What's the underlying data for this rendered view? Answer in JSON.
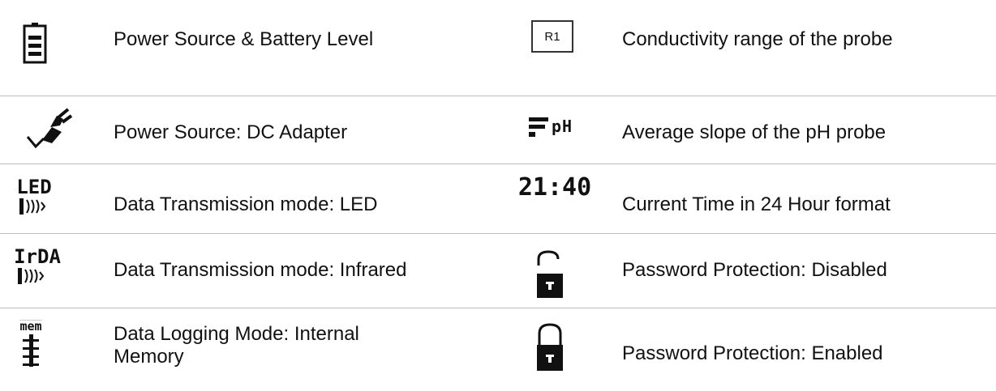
{
  "left_column": [
    {
      "icon": "battery-icon",
      "label": "Power Source & Battery Level"
    },
    {
      "icon": "dc-adapter-plug-icon",
      "label": "Power Source: DC Adapter"
    },
    {
      "icon": "led-transmission-icon",
      "icon_text": "LED",
      "label": "Data Transmission mode: LED"
    },
    {
      "icon": "infrared-transmission-icon",
      "icon_text": "IrDA",
      "label": "Data Transmission mode: Infrared"
    },
    {
      "icon": "internal-memory-icon",
      "icon_text": "mem",
      "label": "Data Logging Mode: Internal Memory"
    }
  ],
  "right_column": [
    {
      "icon": "conductivity-range-icon",
      "icon_text": "R1",
      "label": "Conductivity range of the probe"
    },
    {
      "icon": "ph-slope-icon",
      "icon_text": "pH",
      "label": "Average slope of the pH probe"
    },
    {
      "icon": "clock-time-icon",
      "icon_text": "21:40",
      "label": "Current Time in 24 Hour format"
    },
    {
      "icon": "unlocked-padlock-icon",
      "label": "Password Protection: Disabled"
    },
    {
      "icon": "locked-padlock-icon",
      "label": "Password Protection: Enabled"
    }
  ]
}
